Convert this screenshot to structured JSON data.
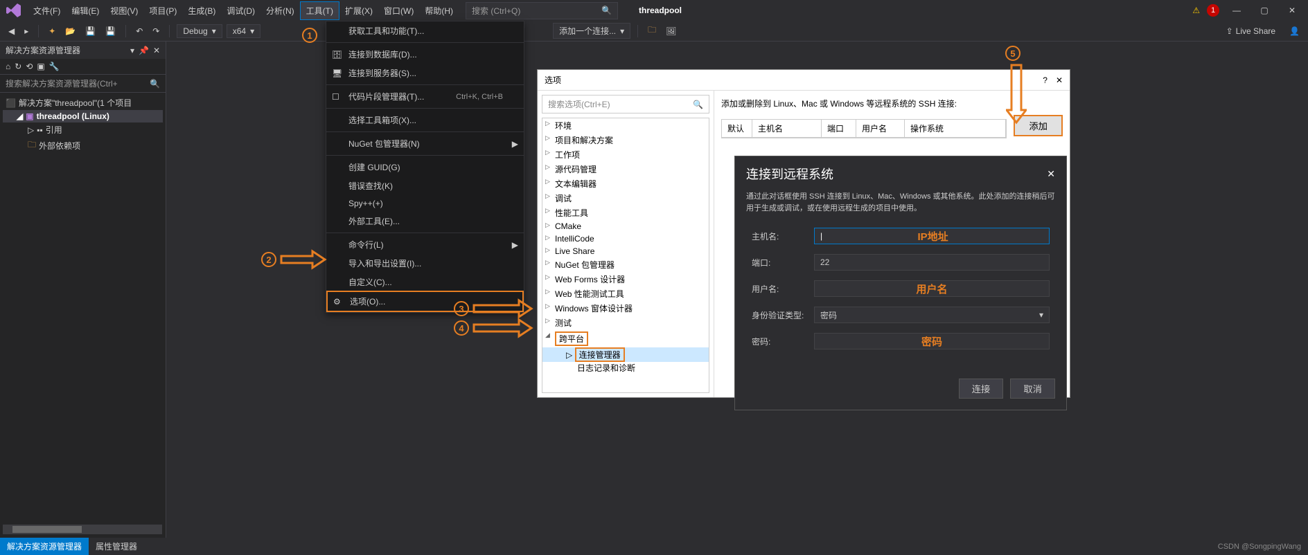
{
  "menubar": {
    "items": [
      "文件(F)",
      "编辑(E)",
      "视图(V)",
      "项目(P)",
      "生成(B)",
      "调试(D)",
      "分析(N)",
      "工具(T)",
      "扩展(X)",
      "窗口(W)",
      "帮助(H)"
    ],
    "active_index": 7,
    "search_placeholder": "搜索 (Ctrl+Q)",
    "project": "threadpool",
    "error_count": "1"
  },
  "toolbar": {
    "config": "Debug",
    "platform": "x64",
    "add_conn": "添加一个连接...",
    "live_share": "Live Share"
  },
  "solution": {
    "title": "解决方案资源管理器",
    "search_placeholder": "搜索解决方案资源管理器(Ctrl+",
    "root": "解决方案\"threadpool\"(1 个项目",
    "project": "threadpool (Linux)",
    "refs": "引用",
    "ext_deps": "外部依赖项"
  },
  "dropdown": [
    {
      "label": "获取工具和功能(T)...",
      "icon": ""
    },
    {
      "sep": true
    },
    {
      "label": "连接到数据库(D)...",
      "icon": "db"
    },
    {
      "label": "连接到服务器(S)...",
      "icon": "srv"
    },
    {
      "sep": true
    },
    {
      "label": "代码片段管理器(T)...",
      "icon": "snip",
      "shortcut": "Ctrl+K, Ctrl+B"
    },
    {
      "sep": true
    },
    {
      "label": "选择工具箱项(X)..."
    },
    {
      "sep": true
    },
    {
      "label": "NuGet 包管理器(N)",
      "sub": true
    },
    {
      "sep": true
    },
    {
      "label": "创建 GUID(G)"
    },
    {
      "label": "错误查找(K)"
    },
    {
      "label": "Spy++(+)"
    },
    {
      "label": "外部工具(E)..."
    },
    {
      "sep": true
    },
    {
      "label": "命令行(L)",
      "sub": true
    },
    {
      "label": "导入和导出设置(I)..."
    },
    {
      "label": "自定义(C)..."
    },
    {
      "label": "选项(O)...",
      "icon": "gear",
      "highlight": true
    }
  ],
  "options_dlg": {
    "title": "选项",
    "search_placeholder": "搜索选项(Ctrl+E)",
    "tree": [
      "环境",
      "项目和解决方案",
      "工作项",
      "源代码管理",
      "文本编辑器",
      "调试",
      "性能工具",
      "CMake",
      "IntelliCode",
      "Live Share",
      "NuGet 包管理器",
      "Web Forms 设计器",
      "Web 性能测试工具",
      "Windows 窗体设计器",
      "测试"
    ],
    "crossplat": "跨平台",
    "conn_mgr": "连接管理器",
    "log_diag": "日志记录和诊断",
    "right_label": "添加或删除到 Linux、Mac 或 Windows 等远程系统的 SSH 连接:",
    "cols": [
      "默认",
      "主机名",
      "端口",
      "用户名",
      "操作系统"
    ],
    "add_btn": "添加"
  },
  "remote": {
    "title": "连接到远程系统",
    "desc": "通过此对话框使用 SSH 连接到 Linux、Mac、Windows 或其他系统。此处添加的连接稍后可用于生成或调试，或在使用远程生成的项目中使用。",
    "host_label": "主机名:",
    "host_ann": "IP地址",
    "port_label": "端口:",
    "port_value": "22",
    "user_label": "用户名:",
    "user_ann": "用户名",
    "auth_label": "身份验证类型:",
    "auth_value": "密码",
    "pwd_label": "密码:",
    "pwd_ann": "密码",
    "connect": "连接",
    "cancel": "取消"
  },
  "bottom": {
    "tab1": "解决方案资源管理器",
    "tab2": "属性管理器"
  },
  "watermark": "CSDN @SongpingWang",
  "annotations": {
    "c1": "1",
    "c2": "2",
    "c3": "3",
    "c4": "4",
    "c5": "5"
  }
}
